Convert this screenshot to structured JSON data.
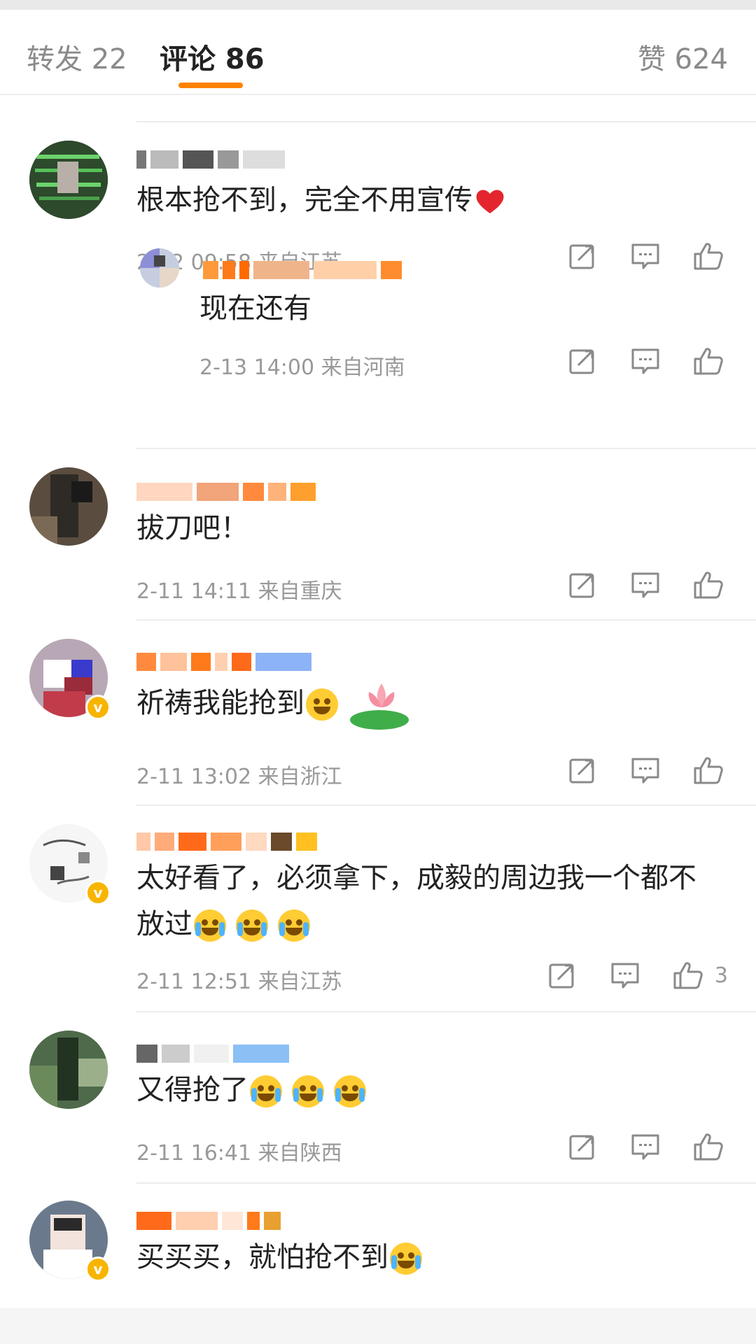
{
  "tabs": {
    "repost": "转发 22",
    "comments": "评论 86",
    "likes": "赞 624"
  },
  "comments": [
    {
      "text": "根本抢不到，完全不用宣传",
      "time": "2-12 09:58",
      "location": "来自江苏",
      "reply": {
        "text": "现在还有",
        "time": "2-13 14:00",
        "location": "来自河南"
      }
    },
    {
      "text": "拔刀吧！",
      "time": "2-11 14:11",
      "location": "来自重庆"
    },
    {
      "text": "祈祷我能抢到",
      "time": "2-11 13:02",
      "location": "来自浙江"
    },
    {
      "text_line1": "太好看了，必须拿下，成毅的周边我一个都不",
      "text_line2": "放过",
      "time": "2-11 12:51",
      "location": "来自江苏",
      "likes": "3"
    },
    {
      "text": "又得抢了",
      "time": "2-11 16:41",
      "location": "来自陕西"
    },
    {
      "text": "买买买，就怕抢不到"
    }
  ],
  "icons": {
    "share": "share-icon",
    "comment": "comment-icon",
    "like": "thumbs-up-icon",
    "heart": "heart-icon",
    "verified": "verified-badge-icon"
  },
  "colors": {
    "accent": "#ff8200",
    "meta": "#999999",
    "verified": "#f7b500"
  }
}
